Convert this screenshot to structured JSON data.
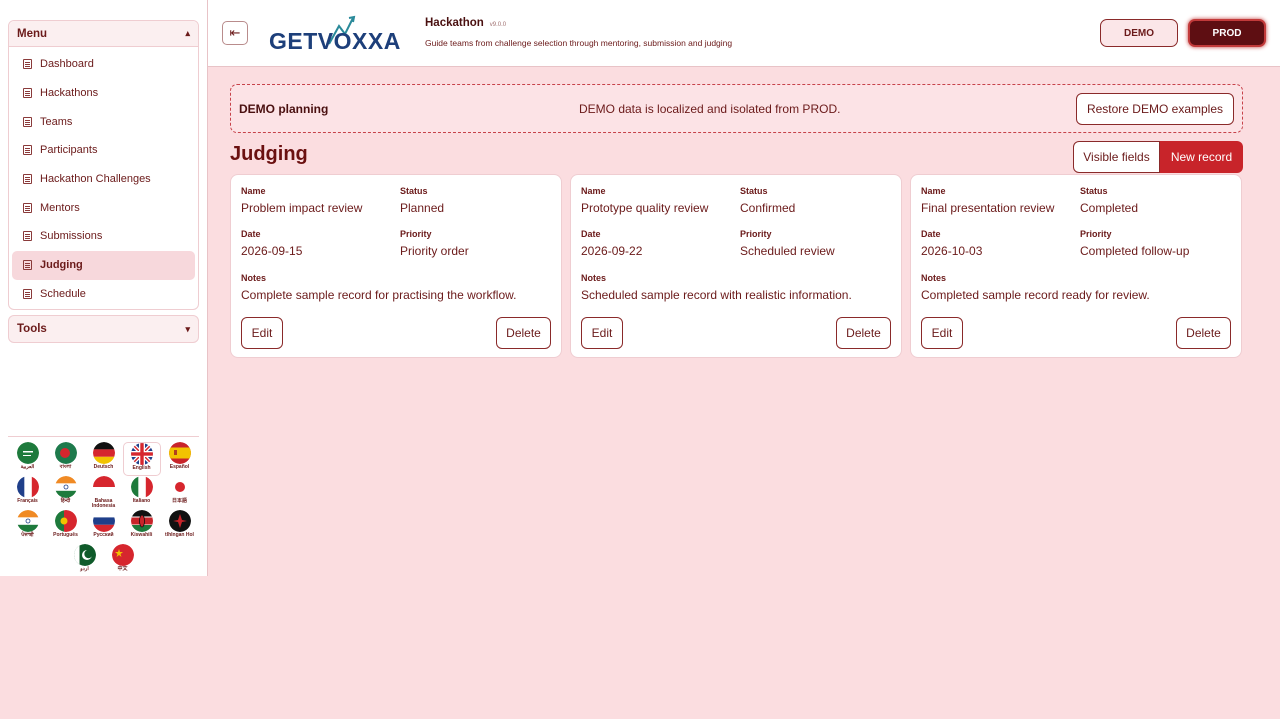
{
  "sidebar": {
    "menu_title": "Menu",
    "items": [
      {
        "label": "Dashboard"
      },
      {
        "label": "Hackathons"
      },
      {
        "label": "Teams"
      },
      {
        "label": "Participants"
      },
      {
        "label": "Hackathon Challenges"
      },
      {
        "label": "Mentors"
      },
      {
        "label": "Submissions"
      },
      {
        "label": "Judging",
        "active": true
      },
      {
        "label": "Schedule"
      }
    ],
    "tools_title": "Tools",
    "languages": [
      {
        "label": "العربية",
        "flag": "sa-flag-icon"
      },
      {
        "label": "বাংলা",
        "flag": "bd-flag-icon"
      },
      {
        "label": "Deutsch",
        "flag": "de-flag-icon"
      },
      {
        "label": "English",
        "flag": "gb-flag-icon",
        "selected": true
      },
      {
        "label": "Español",
        "flag": "es-flag-icon"
      },
      {
        "label": "Français",
        "flag": "fr-flag-icon"
      },
      {
        "label": "हिन्दी",
        "flag": "in-flag-icon"
      },
      {
        "label": "Bahasa Indonesia",
        "flag": "id-flag-icon"
      },
      {
        "label": "Italiano",
        "flag": "it-flag-icon"
      },
      {
        "label": "日本語",
        "flag": "jp-flag-icon"
      },
      {
        "label": "ਪੰਜਾਬੀ",
        "flag": "in-flag-icon"
      },
      {
        "label": "Português",
        "flag": "pt-flag-icon"
      },
      {
        "label": "Русский",
        "flag": "ru-flag-icon"
      },
      {
        "label": "Kiswahili",
        "flag": "ke-flag-icon"
      },
      {
        "label": "tlhIngan Hol",
        "flag": "klingon-flag-icon"
      },
      {
        "label": "اردو",
        "flag": "pk-flag-icon"
      },
      {
        "label": "中文",
        "flag": "cn-flag-icon"
      }
    ]
  },
  "header": {
    "logo_text": "GETVOXXA",
    "app_title": "Hackathon",
    "version": "v9.0.0",
    "subtitle": "Guide teams from challenge selection through mentoring, submission and judging",
    "env_demo": "DEMO",
    "env_prod": "PROD"
  },
  "banner": {
    "title": "DEMO planning",
    "message": "DEMO data is localized and isolated from PROD.",
    "restore_label": "Restore DEMO examples"
  },
  "page": {
    "title": "Judging",
    "visible_fields_label": "Visible fields",
    "new_record_label": "New record"
  },
  "labels": {
    "name": "Name",
    "status": "Status",
    "date": "Date",
    "priority": "Priority",
    "notes": "Notes",
    "edit": "Edit",
    "delete": "Delete"
  },
  "records": [
    {
      "name": "Problem impact review",
      "status": "Planned",
      "date": "2026-09-15",
      "priority": "Priority order",
      "notes": "Complete sample record for practising the workflow."
    },
    {
      "name": "Prototype quality review",
      "status": "Confirmed",
      "date": "2026-09-22",
      "priority": "Scheduled review",
      "notes": "Scheduled sample record with realistic information."
    },
    {
      "name": "Final presentation review",
      "status": "Completed",
      "date": "2026-10-03",
      "priority": "Completed follow-up",
      "notes": "Completed sample record ready for review."
    }
  ],
  "colors": {
    "accent": "#c8242a",
    "background": "#fbdde0",
    "text": "#6b1a1a",
    "prod": "#5e0e12"
  }
}
